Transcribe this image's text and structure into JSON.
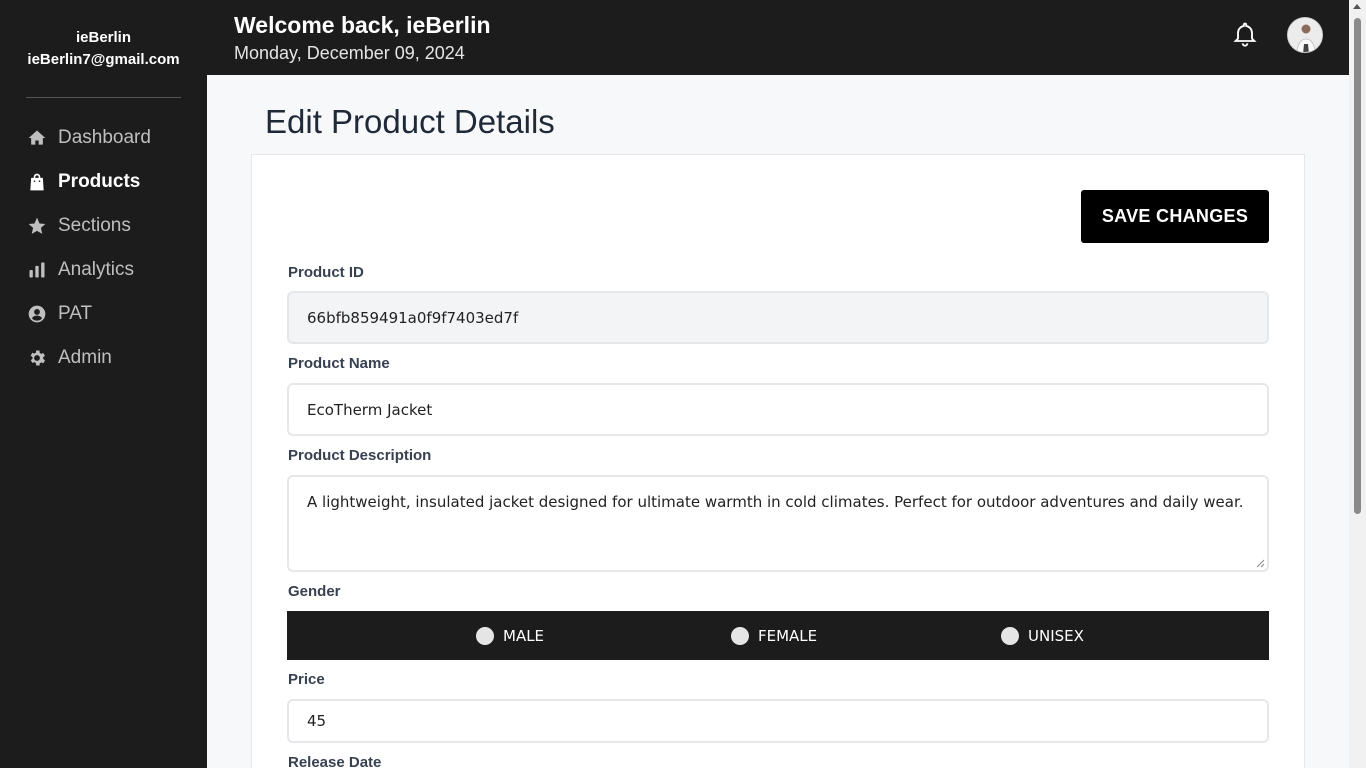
{
  "sidebar": {
    "user_name": "ieBerlin",
    "user_email": "ieBerlin7@gmail.com",
    "items": [
      {
        "label": "Dashboard",
        "icon": "home-icon"
      },
      {
        "label": "Products",
        "icon": "shopping-bag-icon",
        "active": true
      },
      {
        "label": "Sections",
        "icon": "star-icon"
      },
      {
        "label": "Analytics",
        "icon": "bar-chart-icon"
      },
      {
        "label": "PAT",
        "icon": "user-circle-icon"
      },
      {
        "label": "Admin",
        "icon": "gear-icon"
      }
    ]
  },
  "header": {
    "welcome": "Welcome back, ieBerlin",
    "date": "Monday, December 09, 2024"
  },
  "main": {
    "title": "Edit Product Details",
    "save_label": "SAVE CHANGES",
    "fields": {
      "product_id_label": "Product ID",
      "product_id_value": "66bfb859491a0f9f7403ed7f",
      "product_name_label": "Product Name",
      "product_name_value": "EcoTherm Jacket",
      "description_label": "Product Description",
      "description_value": "A lightweight, insulated jacket designed for ultimate warmth in cold climates. Perfect for outdoor adventures and daily wear.",
      "gender_label": "Gender",
      "gender_options": [
        "MALE",
        "FEMALE",
        "UNISEX"
      ],
      "price_label": "Price",
      "price_value": "45",
      "release_date_label": "Release Date"
    }
  },
  "colors": {
    "sidebar_bg": "#1c1c1c",
    "accent": "#000000"
  }
}
